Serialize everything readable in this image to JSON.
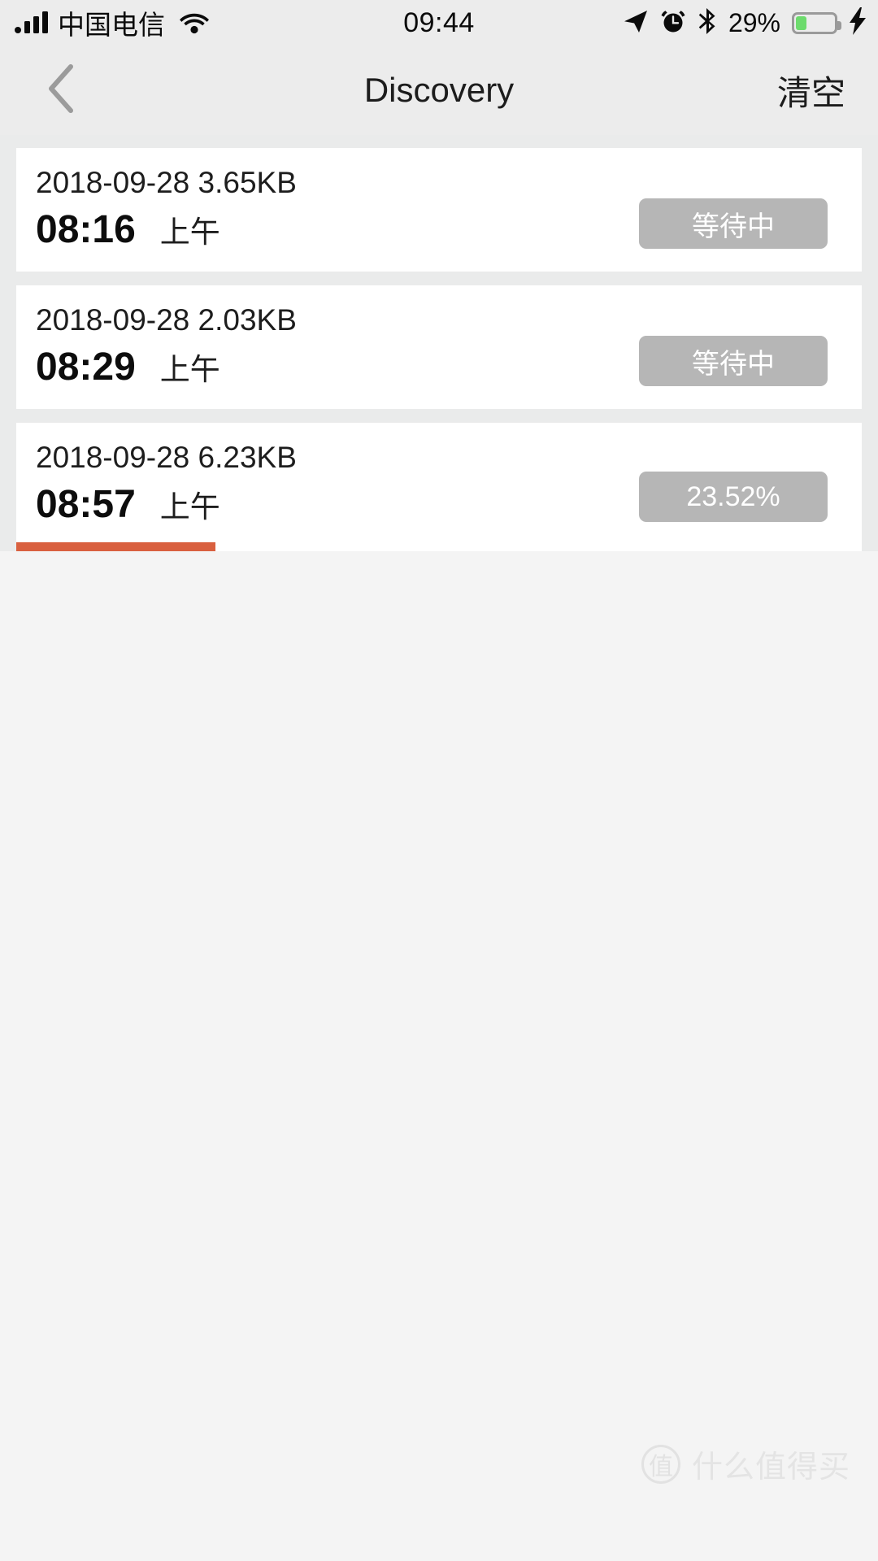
{
  "status_bar": {
    "carrier": "中国电信",
    "signal_icon": "signal-bars-icon",
    "wifi_icon": "wifi-icon",
    "time": "09:44",
    "location_icon": "location-arrow-icon",
    "alarm_icon": "alarm-clock-icon",
    "bluetooth_icon": "bluetooth-icon",
    "battery_percent": "29%",
    "battery_level": 29,
    "battery_color": "#6ddb6d",
    "charging_icon": "lightning-bolt-icon"
  },
  "nav_bar": {
    "back_icon": "chevron-left-icon",
    "title": "Discovery",
    "action_label": "清空"
  },
  "colors": {
    "page_background": "#f4f4f4",
    "list_background": "#eaebeb",
    "card_background": "#ffffff",
    "status_bar_background": "#ececec",
    "button_gray": "#b6b6b6",
    "progress_orange": "#d9603f",
    "text_primary": "#1d1d1d"
  },
  "tasks": [
    {
      "date": "2018-09-28",
      "size": "3.65KB",
      "time": "08:16",
      "meridiem": "上午",
      "status_label": "等待中",
      "progress_percent": 0,
      "has_progress_bar": false
    },
    {
      "date": "2018-09-28",
      "size": "2.03KB",
      "time": "08:29",
      "meridiem": "上午",
      "status_label": "等待中",
      "progress_percent": 0,
      "has_progress_bar": false
    },
    {
      "date": "2018-09-28",
      "size": "6.23KB",
      "time": "08:57",
      "meridiem": "上午",
      "status_label": "23.52%",
      "progress_percent": 23.52,
      "has_progress_bar": true
    }
  ],
  "watermark": {
    "badge": "值",
    "text": "什么值得买"
  }
}
